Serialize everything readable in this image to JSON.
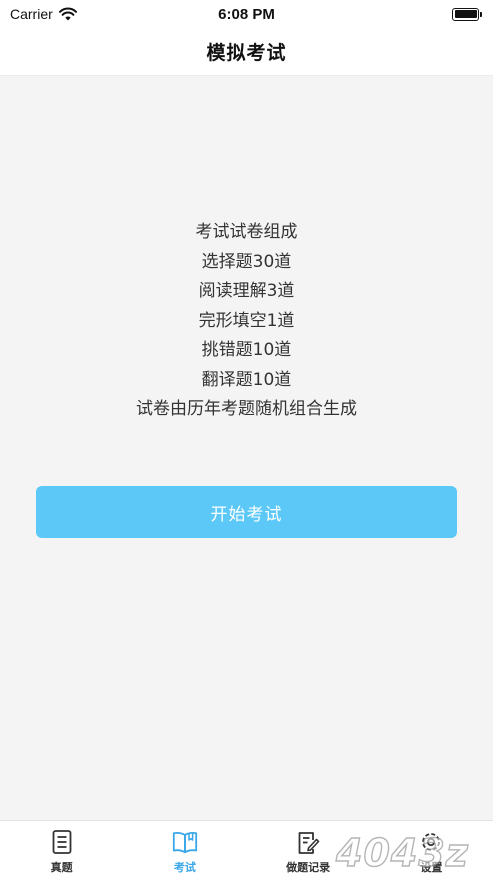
{
  "status_bar": {
    "carrier": "Carrier",
    "time": "6:08 PM"
  },
  "nav": {
    "title": "模拟考试"
  },
  "exam_info": {
    "lines": [
      "考试试卷组成",
      "选择题30道",
      "阅读理解3道",
      "完形填空1道",
      "挑错题10道",
      "翻译题10道",
      "试卷由历年考题随机组合生成"
    ]
  },
  "start_button": {
    "label": "开始考试",
    "color": "#5bc8f7"
  },
  "tab_bar": {
    "active_color": "#3aa7e8",
    "tabs": [
      {
        "label": "真题",
        "icon": "document-icon"
      },
      {
        "label": "考试",
        "icon": "open-book-icon",
        "active": true
      },
      {
        "label": "做题记录",
        "icon": "edit-note-icon"
      },
      {
        "label": "设置",
        "icon": "gear-icon"
      }
    ]
  },
  "watermark": {
    "text": "4043z"
  }
}
